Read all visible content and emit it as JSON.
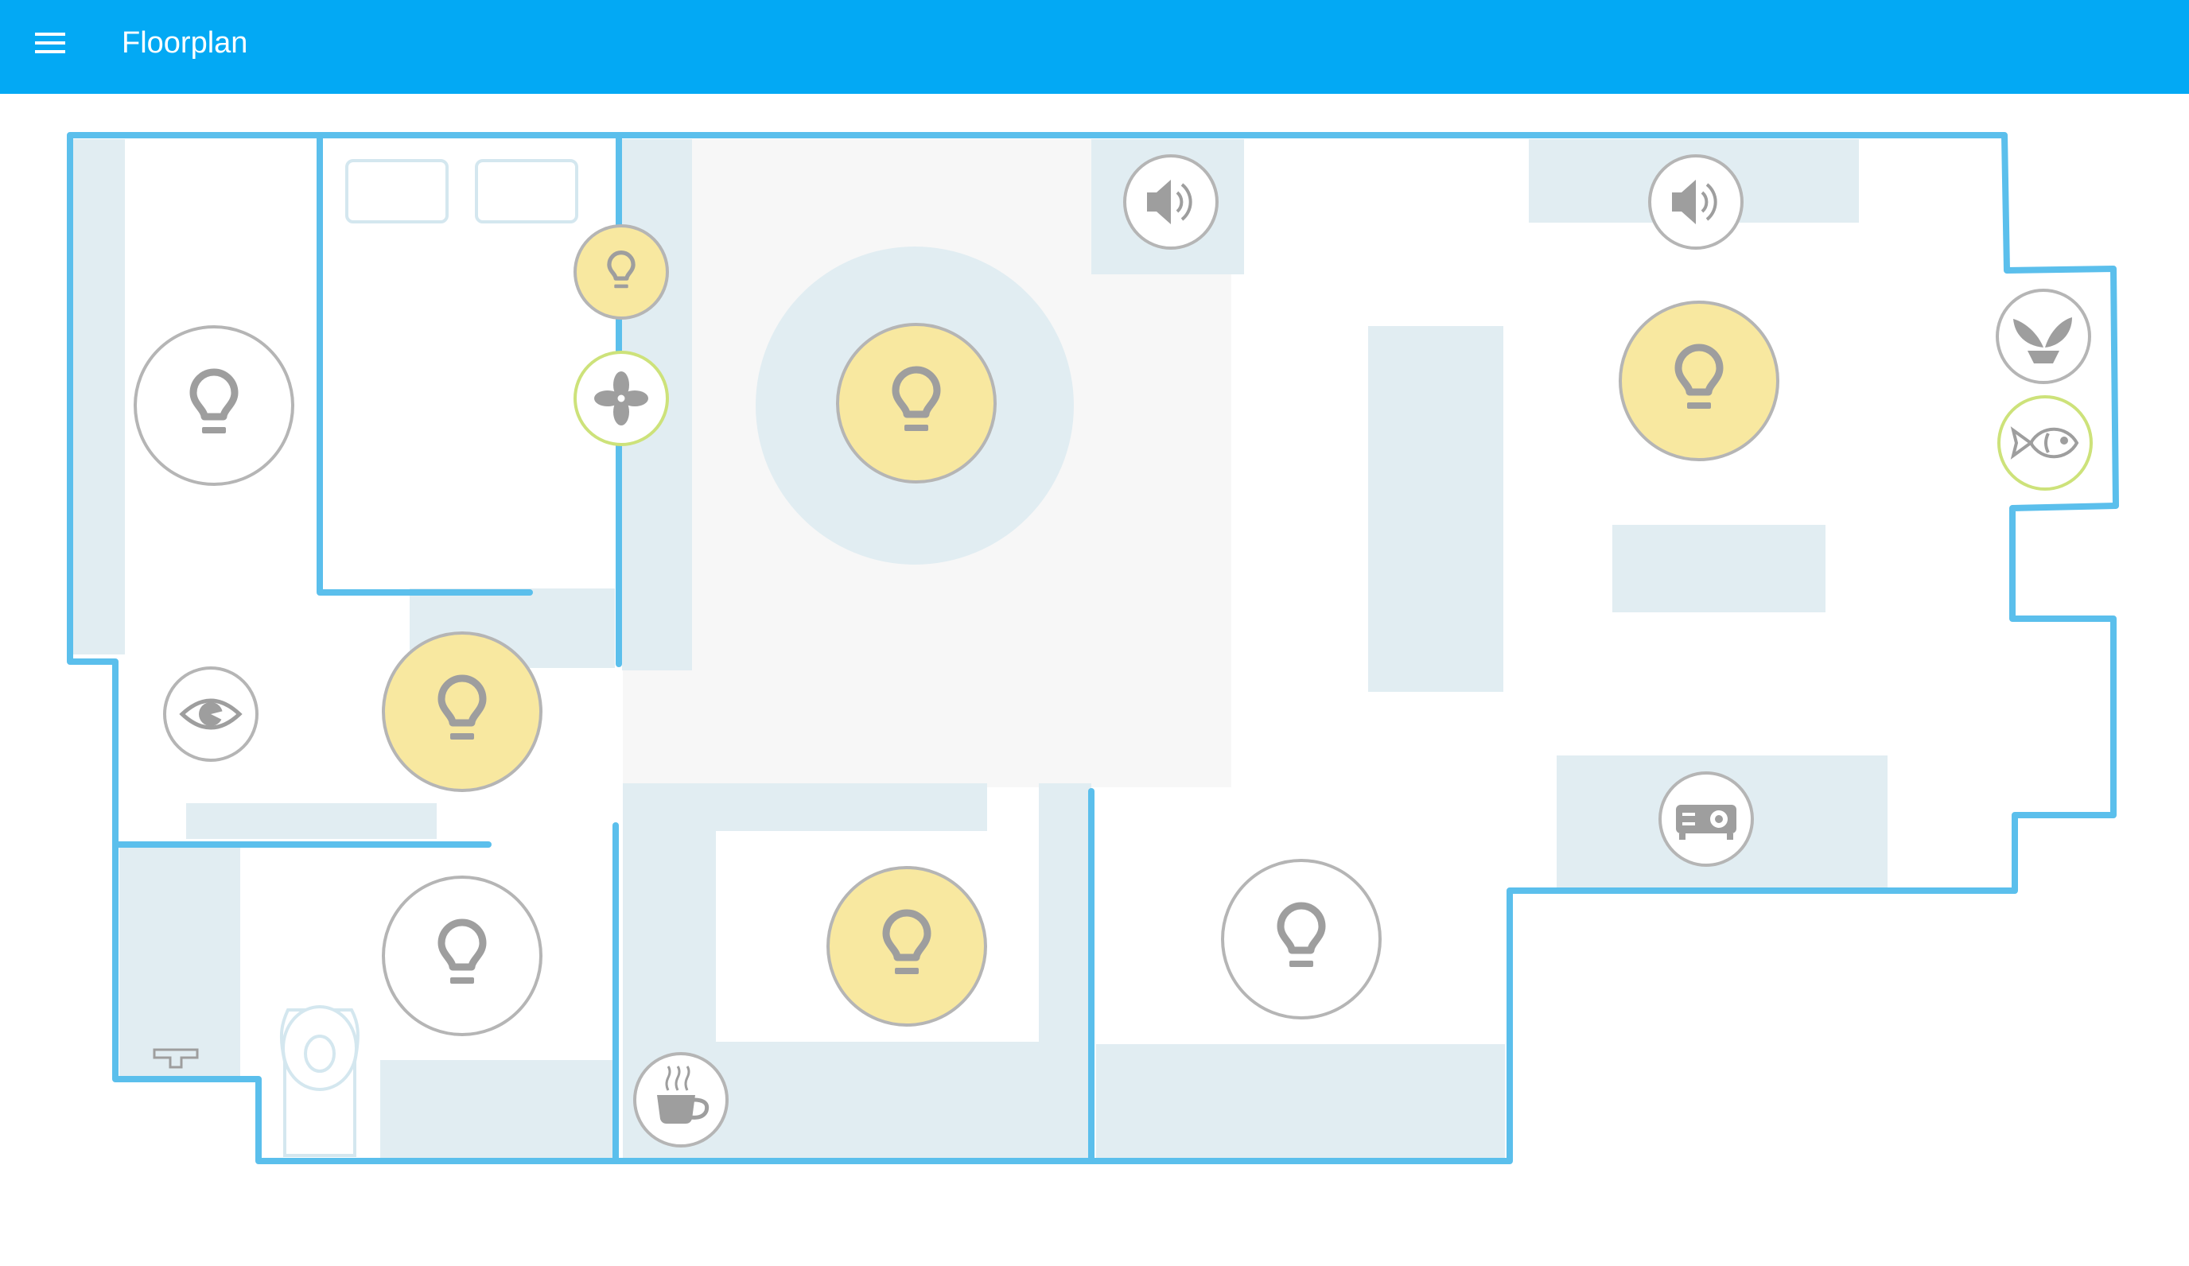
{
  "header": {
    "title": "Floorplan",
    "menu_icon": "menu-icon",
    "background": "#03a9f4"
  },
  "colors": {
    "wall": "#5bbfec",
    "furniture": "#e1edf2",
    "floor_shade": "#f7f7f7",
    "light_on": "#f8e8a0",
    "light_off": "#ffffff",
    "device_ring": "#b5b5b5",
    "active_ring": "#cde27a",
    "icon": "#9e9e9e"
  },
  "devices": [
    {
      "name": "light-bedroom-bedside",
      "icon": "lightbulb-icon",
      "state": "on"
    },
    {
      "name": "fan-bedroom",
      "icon": "fan-icon",
      "state": "on"
    },
    {
      "name": "light-hallway",
      "icon": "lightbulb-icon",
      "state": "off"
    },
    {
      "name": "motion-sensor",
      "icon": "eye-icon",
      "state": "off"
    },
    {
      "name": "light-entrance",
      "icon": "lightbulb-icon",
      "state": "on"
    },
    {
      "name": "light-bathroom",
      "icon": "lightbulb-icon",
      "state": "off"
    },
    {
      "name": "light-living-center",
      "icon": "lightbulb-icon",
      "state": "on"
    },
    {
      "name": "speaker-living",
      "icon": "speaker-icon",
      "state": "off"
    },
    {
      "name": "speaker-dining",
      "icon": "speaker-icon",
      "state": "off"
    },
    {
      "name": "light-dining",
      "icon": "lightbulb-icon",
      "state": "on"
    },
    {
      "name": "plant-sensor",
      "icon": "plant-icon",
      "state": "off"
    },
    {
      "name": "aquarium",
      "icon": "fish-icon",
      "state": "on"
    },
    {
      "name": "projector",
      "icon": "projector-icon",
      "state": "off"
    },
    {
      "name": "light-office",
      "icon": "lightbulb-icon",
      "state": "off"
    },
    {
      "name": "light-kitchen",
      "icon": "lightbulb-icon",
      "state": "on"
    },
    {
      "name": "coffee-machine",
      "icon": "coffee-icon",
      "state": "off"
    }
  ]
}
